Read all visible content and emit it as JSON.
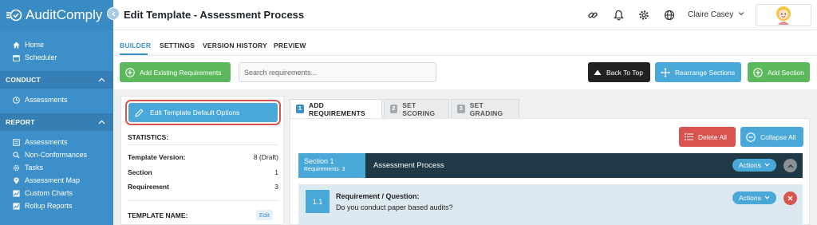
{
  "app": {
    "name": "AuditComply"
  },
  "sidebar": {
    "top_items": [
      {
        "label": "Home",
        "icon": "home-icon"
      },
      {
        "label": "Scheduler",
        "icon": "calendar-icon"
      }
    ],
    "sections": [
      {
        "title": "CONDUCT",
        "items": [
          {
            "label": "Assessments",
            "icon": "clock-icon"
          }
        ]
      },
      {
        "title": "REPORT",
        "items": [
          {
            "label": "Assessments",
            "icon": "list-icon"
          },
          {
            "label": "Non-Conformances",
            "icon": "search-doc-icon"
          },
          {
            "label": "Tasks",
            "icon": "gear-icon"
          },
          {
            "label": "Assessment Map",
            "icon": "map-pin-icon"
          },
          {
            "label": "Custom Charts",
            "icon": "chart-icon"
          },
          {
            "label": "Rollup Reports",
            "icon": "chart-icon"
          }
        ]
      }
    ]
  },
  "header": {
    "title": "Edit Template - Assessment Process",
    "user_name": "Claire Casey"
  },
  "tabs": [
    {
      "label": "BUILDER",
      "active": true
    },
    {
      "label": "SETTINGS",
      "active": false
    },
    {
      "label": "VERSION HISTORY",
      "active": false
    },
    {
      "label": "PREVIEW",
      "active": false
    }
  ],
  "toolbar": {
    "add_existing": "Add Existing Requirements",
    "search_placeholder": "Search requirements...",
    "back_to_top": "Back To Top",
    "rearrange": "Rearrange Sections",
    "add_section": "Add Section"
  },
  "left_panel": {
    "edit_defaults": "Edit Template Default Options",
    "statistics_title": "STATISTICS:",
    "stats": [
      {
        "label": "Template Version:",
        "value": "8 (Draft)"
      },
      {
        "label": "Section",
        "value": "1"
      },
      {
        "label": "Requirement",
        "value": "3"
      }
    ],
    "template_name_title": "TEMPLATE NAME:",
    "edit_label": "Edit"
  },
  "steps": [
    {
      "num": "1",
      "label": "ADD REQUIREMENTS",
      "active": true
    },
    {
      "num": "2",
      "label": "SET SCORING",
      "active": false
    },
    {
      "num": "3",
      "label": "SET GRADING",
      "active": false
    }
  ],
  "actions": {
    "delete_all": "Delete All",
    "collapse_all": "Collapse All"
  },
  "section": {
    "label": "Section 1",
    "requirements": "Requirements: 3",
    "name": "Assessment Process",
    "actions_label": "Actions"
  },
  "requirement": {
    "num": "1.1",
    "title": "Requirement / Question:",
    "question": "Do you conduct paper based audits?",
    "actions_label": "Actions"
  },
  "colors": {
    "sidebar": "#3d8fc9",
    "accent_blue": "#4aa8d8",
    "green": "#5cb85c",
    "red": "#d9534f",
    "dark": "#1f3a46"
  }
}
